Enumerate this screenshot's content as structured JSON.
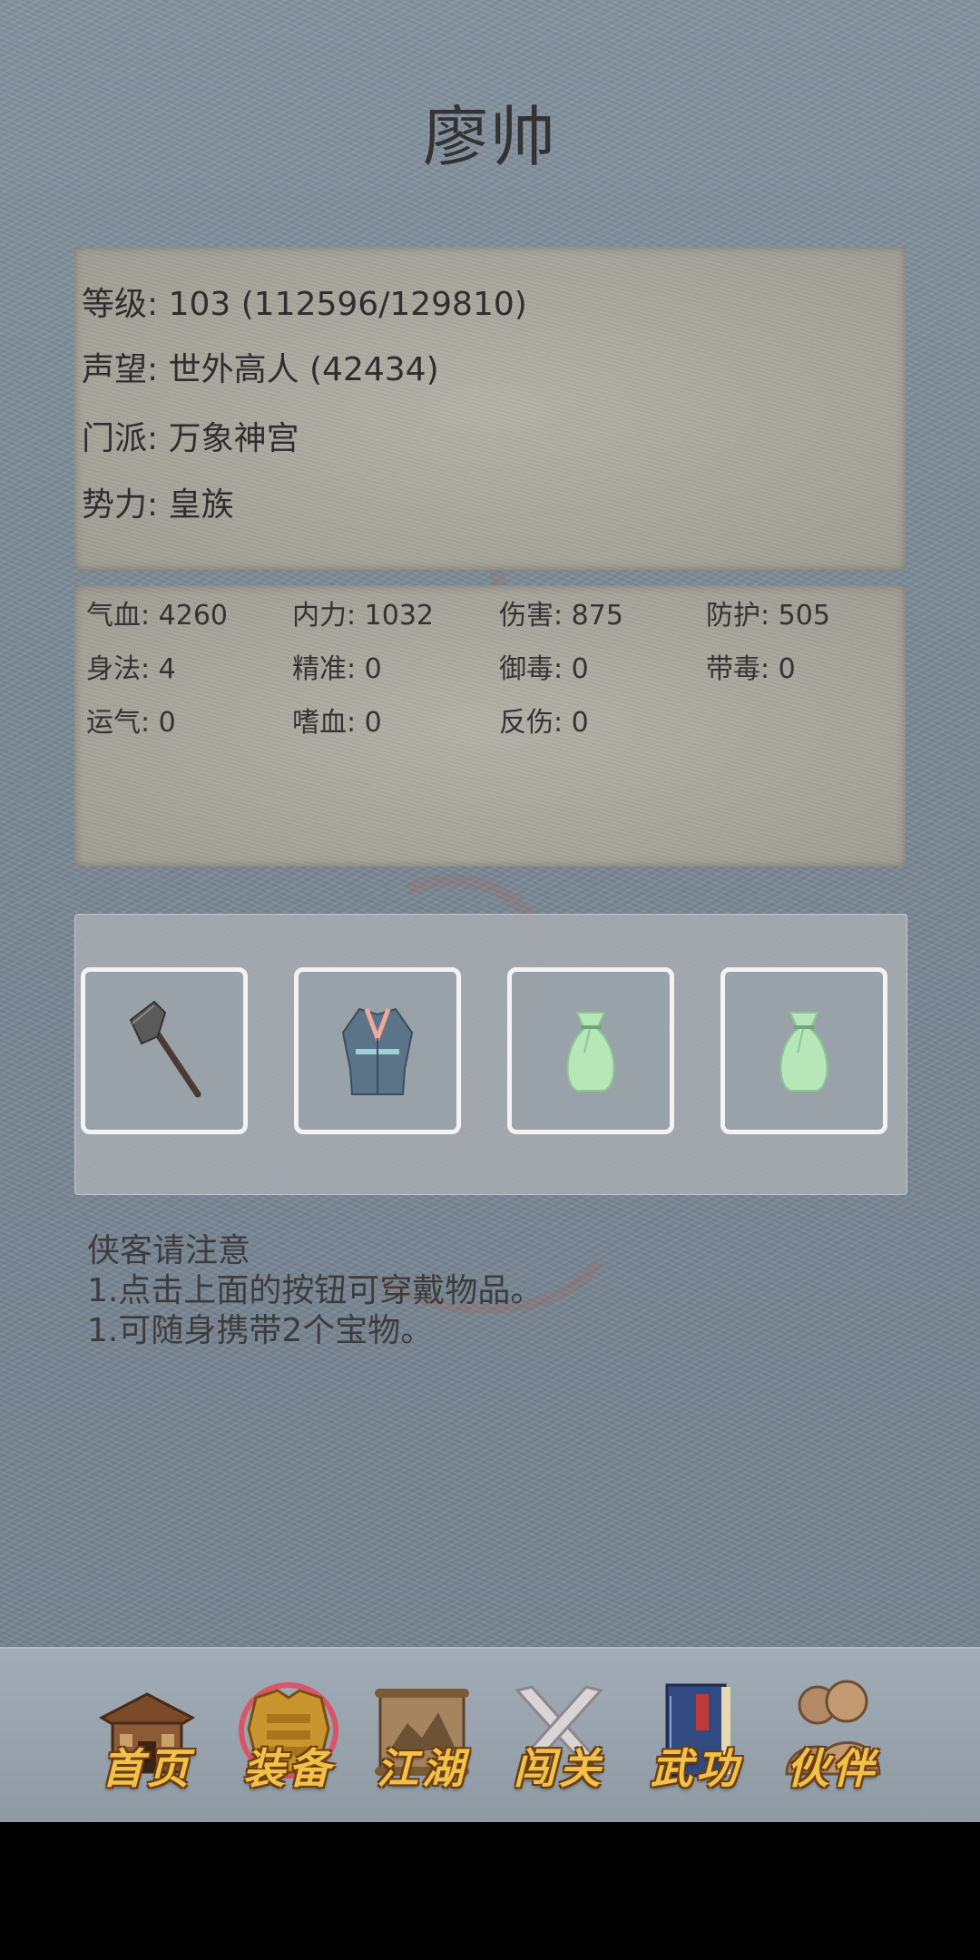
{
  "header": {
    "title": "廖帅"
  },
  "profile": {
    "level": "等级: 103 (112596/129810)",
    "reputation": "声望: 世外高人 (42434)",
    "sect": "门派: 万象神宫",
    "faction": "势力:  皇族"
  },
  "stats": [
    [
      "气血: 4260",
      "内力: 1032",
      "伤害: 875",
      "防护: 505"
    ],
    [
      "身法: 4",
      "精准: 0",
      "御毒: 0",
      "带毒: 0"
    ],
    [
      "运气: 0",
      "嗜血: 0",
      "反伤: 0"
    ]
  ],
  "equipment": {
    "slots": [
      {
        "icon": "axe-icon"
      },
      {
        "icon": "robe-icon"
      },
      {
        "icon": "pouch-icon"
      },
      {
        "icon": "pouch-icon"
      }
    ]
  },
  "notes": {
    "heading": "侠客请注意",
    "line1": "1.点击上面的按钮可穿戴物品。",
    "line2": "1.可随身携带2个宝物。"
  },
  "nav": {
    "items": [
      {
        "label": "首页",
        "icon": "house-icon"
      },
      {
        "label": "装备",
        "icon": "armor-icon",
        "active": true
      },
      {
        "label": "江湖",
        "icon": "scroll-icon"
      },
      {
        "label": "闯关",
        "icon": "crossed-swords-icon"
      },
      {
        "label": "武功",
        "icon": "book-icon"
      },
      {
        "label": "伙伴",
        "icon": "companions-icon"
      }
    ]
  },
  "colors": {
    "title": "#333333",
    "nav_label": "#f2c14a",
    "pouch": "#b7e6b9"
  }
}
